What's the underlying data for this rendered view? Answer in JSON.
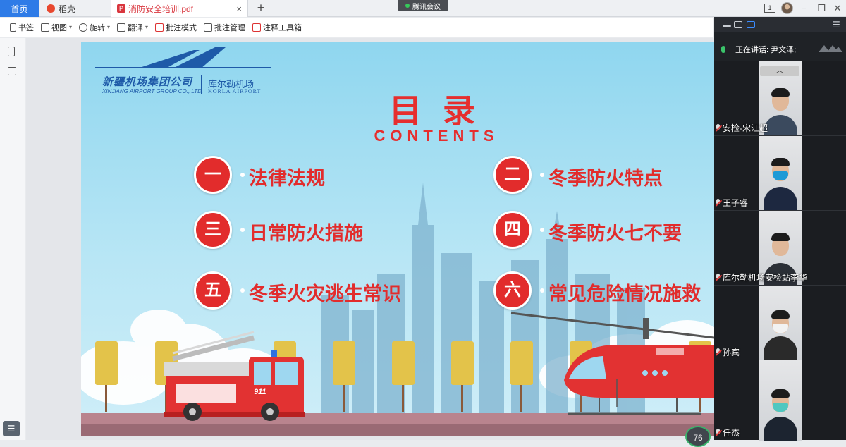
{
  "tabs": {
    "home": "首页",
    "daoke": "稻壳",
    "pdf": "消防安全培训.pdf",
    "close": "×",
    "add": "+"
  },
  "meeting": {
    "label": "腾讯会议"
  },
  "window": {
    "page_indicator": "1",
    "minimize": "−",
    "restore": "❐",
    "close": "✕"
  },
  "toolbar": [
    {
      "label": "书签",
      "caret": ""
    },
    {
      "label": "视图",
      "caret": "▾"
    },
    {
      "label": "旋转",
      "caret": "▾"
    },
    {
      "label": "翻译",
      "caret": "▾"
    },
    {
      "label": "批注模式",
      "caret": ""
    },
    {
      "label": "批注管理",
      "caret": ""
    },
    {
      "label": "注释工具箱",
      "caret": ""
    }
  ],
  "slide": {
    "logo_cn": "新疆机场集团公司",
    "logo_en": "XINJIANG AIRPORT GROUP CO., LTD.",
    "logo_cn2": "库尔勒机场",
    "logo_en2": "KORLA AIRPORT",
    "title": "目录",
    "subtitle": "CONTENTS",
    "items": [
      {
        "num": "一",
        "text": "法律法规"
      },
      {
        "num": "二",
        "text": "冬季防火特点"
      },
      {
        "num": "三",
        "text": "日常防火措施"
      },
      {
        "num": "四",
        "text": "冬季防火七不要"
      },
      {
        "num": "五",
        "text": "冬季火灾逃生常识"
      },
      {
        "num": "六",
        "text": "常见危险情况施救"
      }
    ],
    "truck_number": "911"
  },
  "meeting_panel": {
    "speaking_label": "正在讲话: 尹文泽;",
    "collapse": "︿",
    "participants": [
      {
        "name": "安检-宋江超",
        "mask": false,
        "clothes": "#3b4a5e"
      },
      {
        "name": "王子睿",
        "mask": true,
        "mask_color": "#1e9ad6",
        "clothes": "#1d2840"
      },
      {
        "name": "库尔勒机场安检站李华",
        "mask": false,
        "clothes": "#2b2f36"
      },
      {
        "name": "孙宾",
        "mask": true,
        "mask_color": "#f2f2f2",
        "clothes": "#2a2a2a"
      },
      {
        "name": "任杰",
        "mask": true,
        "mask_color": "#4fc7c0",
        "clothes": "#1c2430"
      }
    ],
    "timer": "76"
  }
}
